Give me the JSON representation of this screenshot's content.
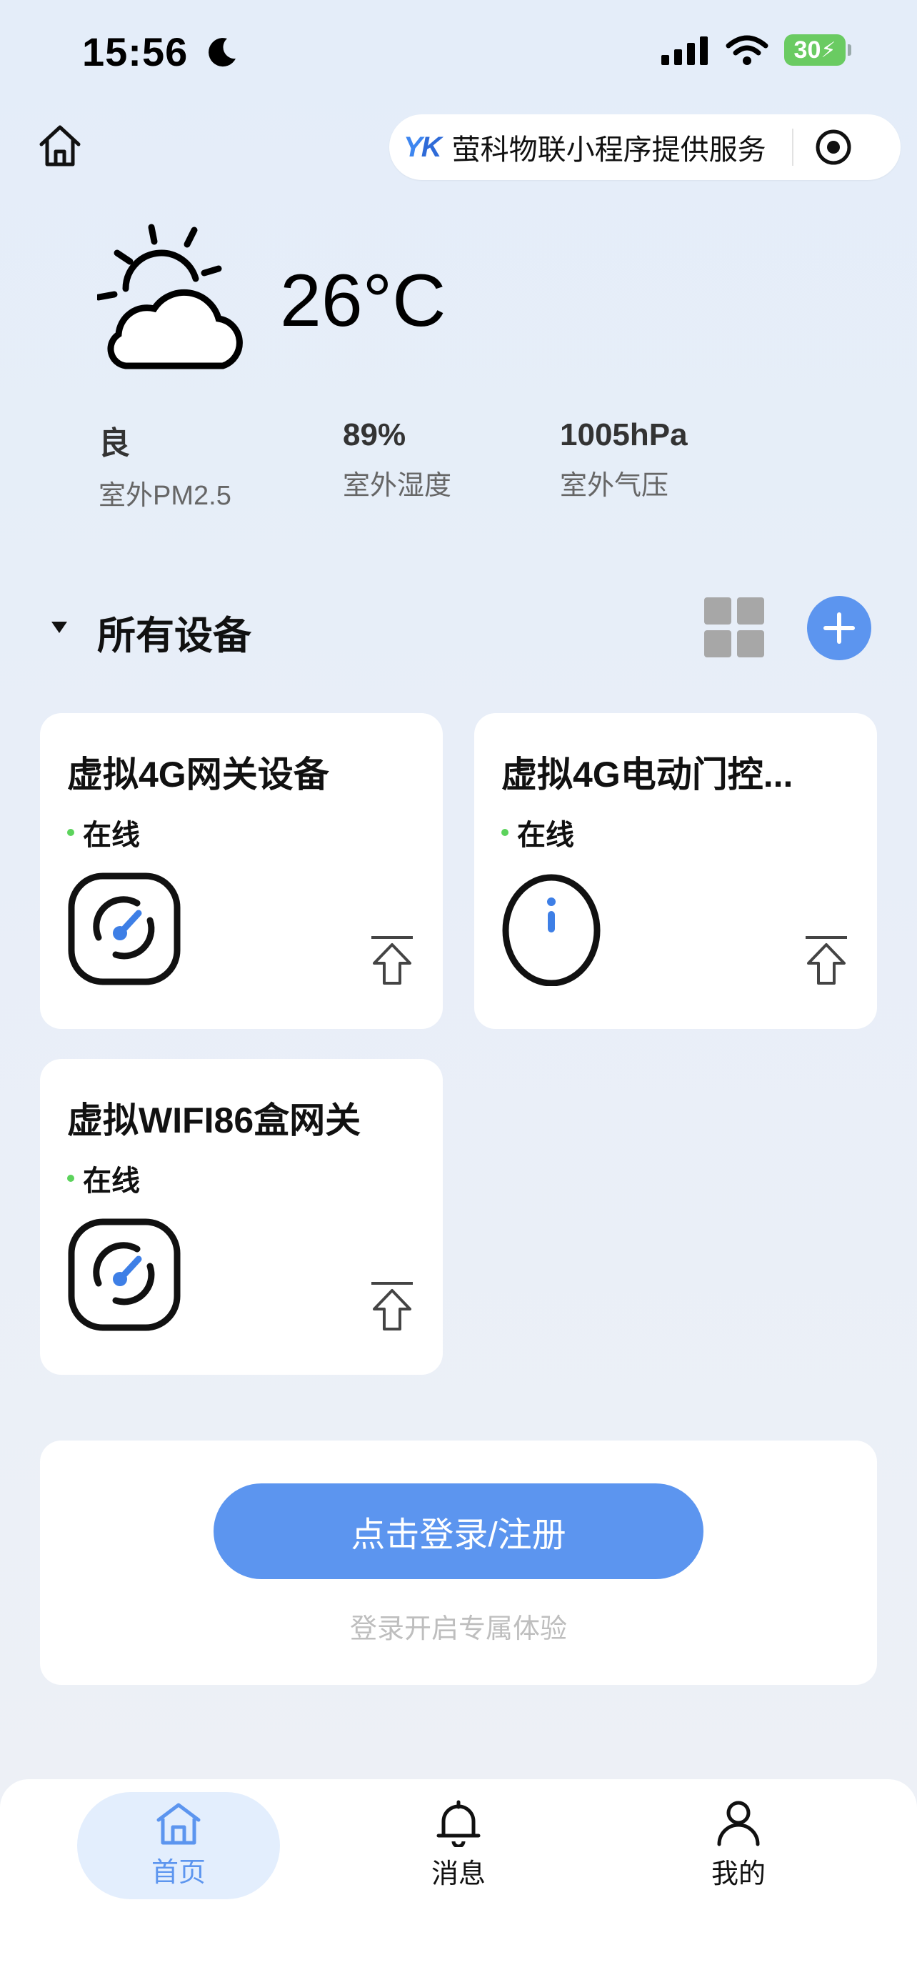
{
  "status_bar": {
    "time": "15:56",
    "battery": "30"
  },
  "top_bar": {
    "mini_brand_y": "Y",
    "mini_brand_k": "K",
    "mini_text": "萤科物联小程序提供服务"
  },
  "weather": {
    "temperature": "26°C",
    "stats": [
      {
        "value": "良",
        "label": "室外PM2.5"
      },
      {
        "value": "89%",
        "label": "室外湿度"
      },
      {
        "value": "1005hPa",
        "label": "室外气压"
      }
    ]
  },
  "devices": {
    "title": "所有设备",
    "items": [
      {
        "name": "虚拟4G网关设备",
        "status": "在线",
        "icon": "gateway-icon"
      },
      {
        "name": "虚拟4G电动门控...",
        "status": "在线",
        "icon": "door-controller-icon"
      },
      {
        "name": "虚拟WIFI86盒网关",
        "status": "在线",
        "icon": "gateway-icon"
      }
    ]
  },
  "login": {
    "button": "点击登录/注册",
    "subtitle": "登录开启专属体验"
  },
  "tabbar": {
    "items": [
      {
        "label": "首页",
        "icon": "home-icon",
        "active": true,
        "color": "#5C95EF"
      },
      {
        "label": "消息",
        "icon": "bell-icon",
        "active": false,
        "color": "#111111"
      },
      {
        "label": "我的",
        "icon": "user-icon",
        "active": false,
        "color": "#111111"
      }
    ]
  },
  "colors": {
    "accent": "#5C95EF",
    "online": "#5CD35C"
  }
}
